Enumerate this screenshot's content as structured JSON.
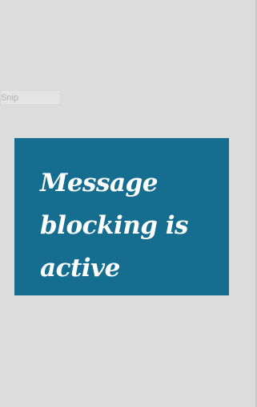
{
  "snip_field": {
    "placeholder": "Snip"
  },
  "message": {
    "text": "Message blocking is active"
  },
  "colors": {
    "background": "#dcdcdc",
    "panel": "#156e8f",
    "panel_text": "#ffffff"
  }
}
